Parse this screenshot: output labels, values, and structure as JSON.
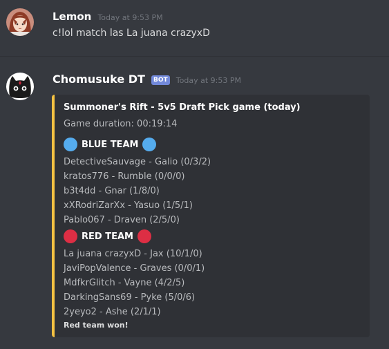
{
  "messages": [
    {
      "author": "Lemon",
      "timestamp": "Today at 9:53 PM",
      "text": "c!lol match las La juana crazyxD"
    },
    {
      "author": "Chomusuke DT",
      "bot_tag": "BOT",
      "timestamp": "Today at 9:53 PM"
    }
  ],
  "embed": {
    "accent_color": "#f5c242",
    "title": "Summoner's Rift - 5v5 Draft Pick game (today)",
    "duration": "Game duration: 00:19:14",
    "blue_team": {
      "name": "BLUE TEAM",
      "color": "#55acee",
      "players": [
        "DetectiveSauvage - Galio (0/3/2)",
        "kratos776 - Rumble (0/0/0)",
        "b3t4dd - Gnar (1/8/0)",
        "xXRodriZarXx - Yasuo (1/5/1)",
        "Pablo067 - Draven (2/5/0)"
      ]
    },
    "red_team": {
      "name": "RED TEAM",
      "color": "#dd2e44",
      "players": [
        "La juana crazyxD - Jax (10/1/0)",
        "JaviPopValence - Graves (0/0/1)",
        "MdfkrGlitch - Vayne (4/2/5)",
        "DarkingSans69 - Pyke (5/0/6)",
        "2yeyo2 - Ashe (2/1/1)"
      ]
    },
    "footer": "Red team won!"
  }
}
